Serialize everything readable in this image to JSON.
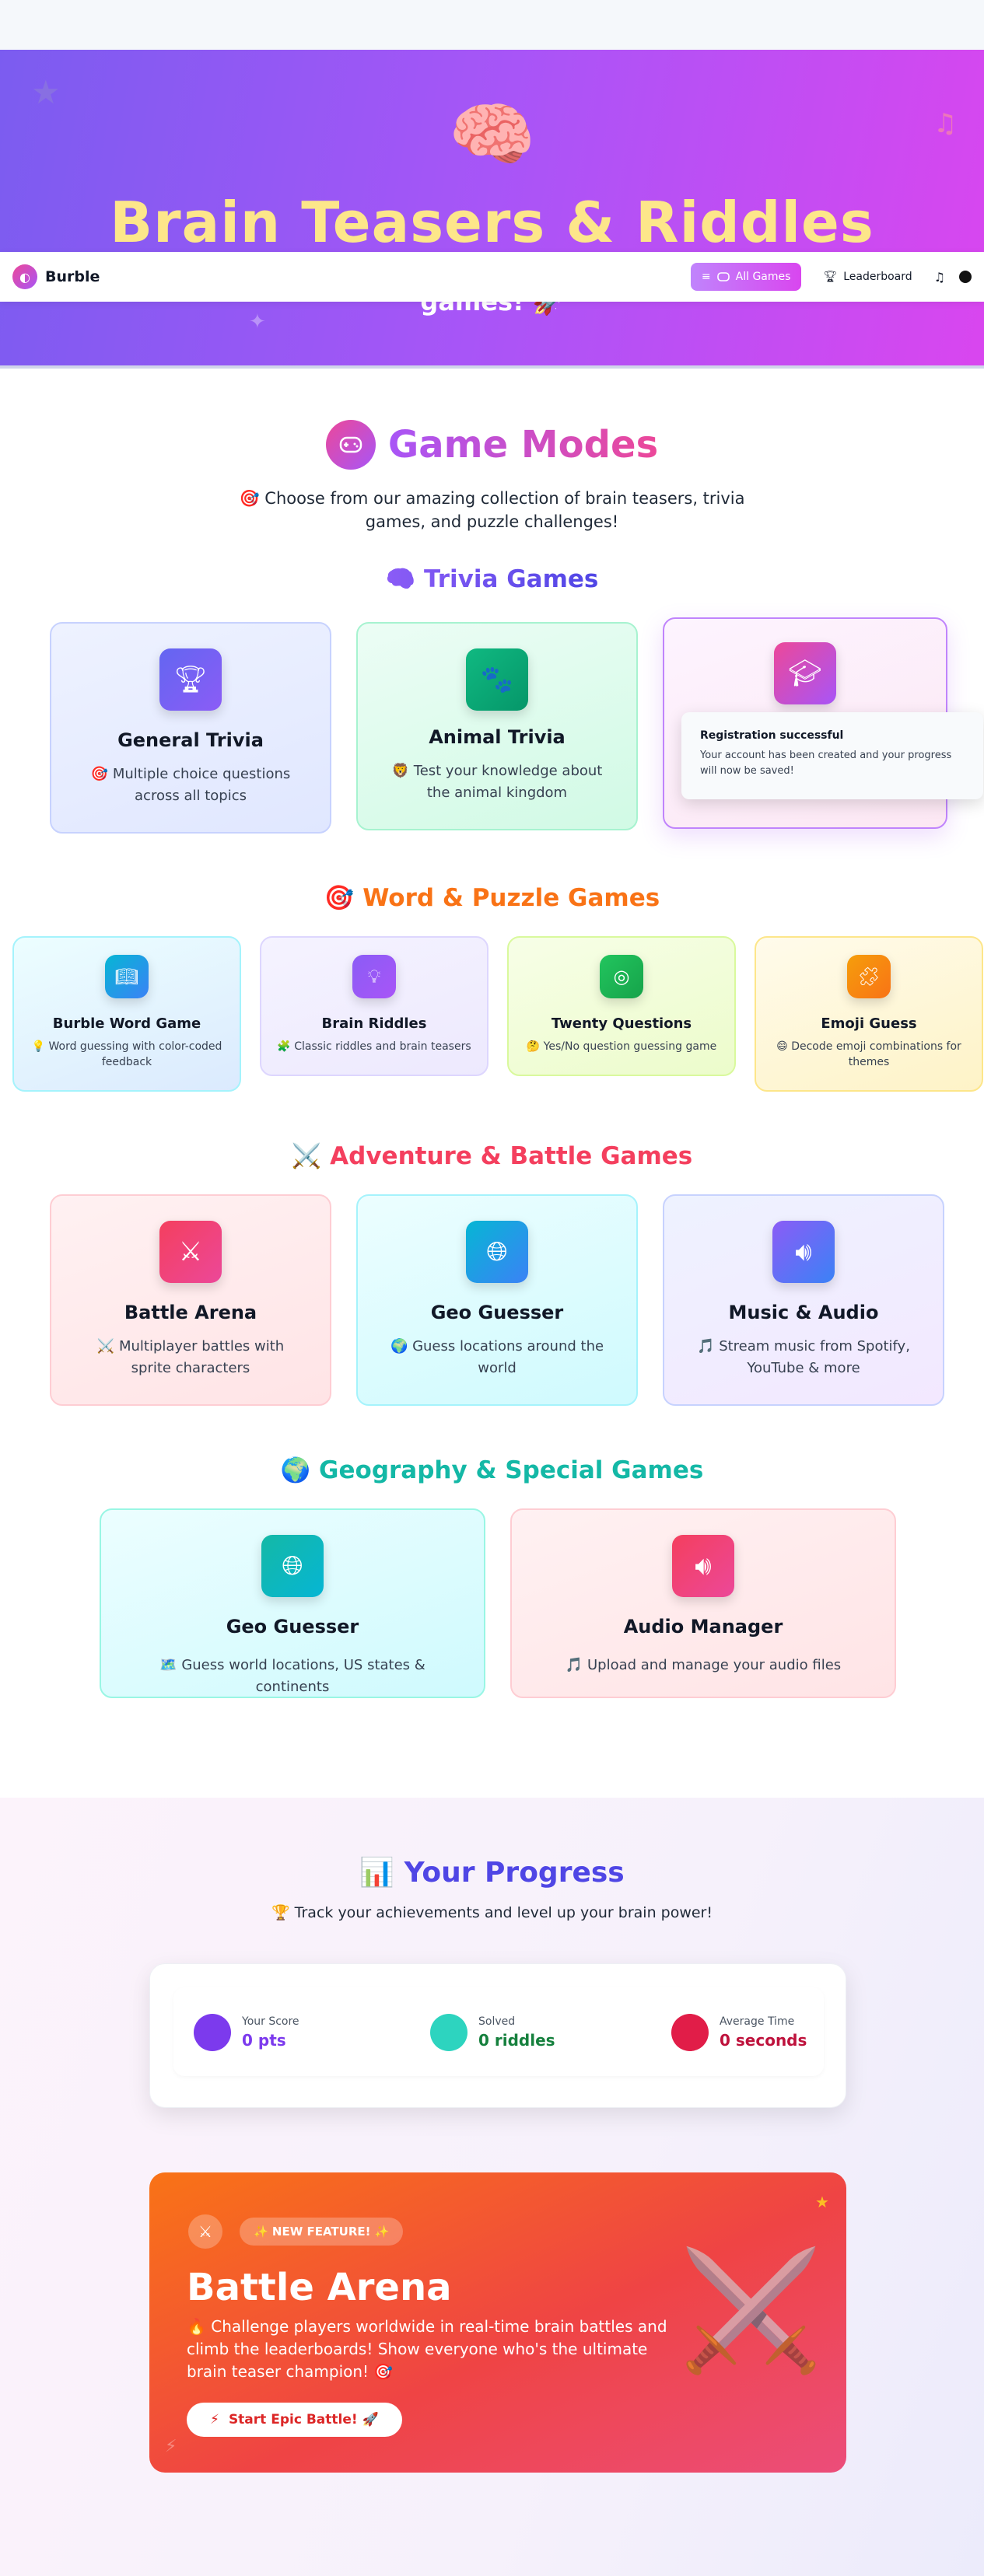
{
  "hero": {
    "emoji": "🧠",
    "title": "Brain Teasers & Riddles",
    "subtitle_visible": "games! 🚀",
    "deco_star": "★",
    "deco_note": "♫",
    "deco_spark": "✦"
  },
  "navbar": {
    "logo_glyph": "◐",
    "brand": "Burble",
    "all_games": "All Games",
    "leaderboard": "Leaderboard"
  },
  "game_modes": {
    "title": "Game Modes",
    "description": "🎯 Choose from our amazing collection of brain teasers, trivia games, and puzzle challenges!"
  },
  "categories": {
    "trivia": {
      "title": "🧠 Trivia Games",
      "cards": [
        {
          "title": "General Trivia",
          "desc": "🎯 Multiple choice questions across all topics",
          "icon": "trophy-icon"
        },
        {
          "title": "Animal Trivia",
          "desc": "🦁 Test your knowledge about the animal kingdom",
          "icon": "paw-icon"
        },
        {
          "title": "",
          "desc": "",
          "icon": "graduation-cap-icon"
        }
      ]
    },
    "word": {
      "title": "🎯 Word & Puzzle Games",
      "cards": [
        {
          "title": "Burble Word Game",
          "desc": "💡 Word guessing with color-coded feedback",
          "icon": "book-icon"
        },
        {
          "title": "Brain Riddles",
          "desc": "🧩 Classic riddles and brain teasers",
          "icon": "lightbulb-icon"
        },
        {
          "title": "Twenty Questions",
          "desc": "🤔 Yes/No question guessing game",
          "icon": "target-icon"
        },
        {
          "title": "Emoji Guess",
          "desc": "😄 Decode emoji combinations for themes",
          "icon": "puzzle-icon"
        }
      ]
    },
    "adventure": {
      "title": "⚔️ Adventure & Battle Games",
      "cards": [
        {
          "title": "Battle Arena",
          "desc": "⚔️ Multiplayer battles with sprite characters",
          "icon": "swords-icon"
        },
        {
          "title": "Geo Guesser",
          "desc": "🌍 Guess locations around the world",
          "icon": "globe-icon"
        },
        {
          "title": "Music & Audio",
          "desc": "🎵 Stream music from Spotify, YouTube & more",
          "icon": "speaker-icon"
        }
      ]
    },
    "geography": {
      "title": "🌍 Geography & Special Games",
      "cards": [
        {
          "title": "Geo Guesser",
          "desc": "🗺️ Guess world locations, US states & continents",
          "icon": "globe-icon"
        },
        {
          "title": "Audio Manager",
          "desc": "🎵 Upload and manage your audio files",
          "icon": "speaker-icon"
        }
      ]
    }
  },
  "toast": {
    "title": "Registration successful",
    "body": "Your account has been created and your progress will now be saved!"
  },
  "progress": {
    "title": "📊 Your Progress",
    "description": "🏆 Track your achievements and level up your brain power!",
    "stats": [
      {
        "label": "Your Score",
        "value": "0 pts",
        "color": "#7c3aed"
      },
      {
        "label": "Solved",
        "value": "0 riddles",
        "color": "#2dd4bf"
      },
      {
        "label": "Average Time",
        "value": "0 seconds",
        "color": "#e11d48"
      }
    ]
  },
  "battle": {
    "badge": "✨ NEW FEATURE! ✨",
    "title": "Battle Arena",
    "description": "🔥 Challenge players worldwide in real-time brain battles and climb the leaderboards! Show everyone who's the ultimate brain teaser champion! 🎯",
    "button": "Start Epic Battle! 🚀"
  }
}
